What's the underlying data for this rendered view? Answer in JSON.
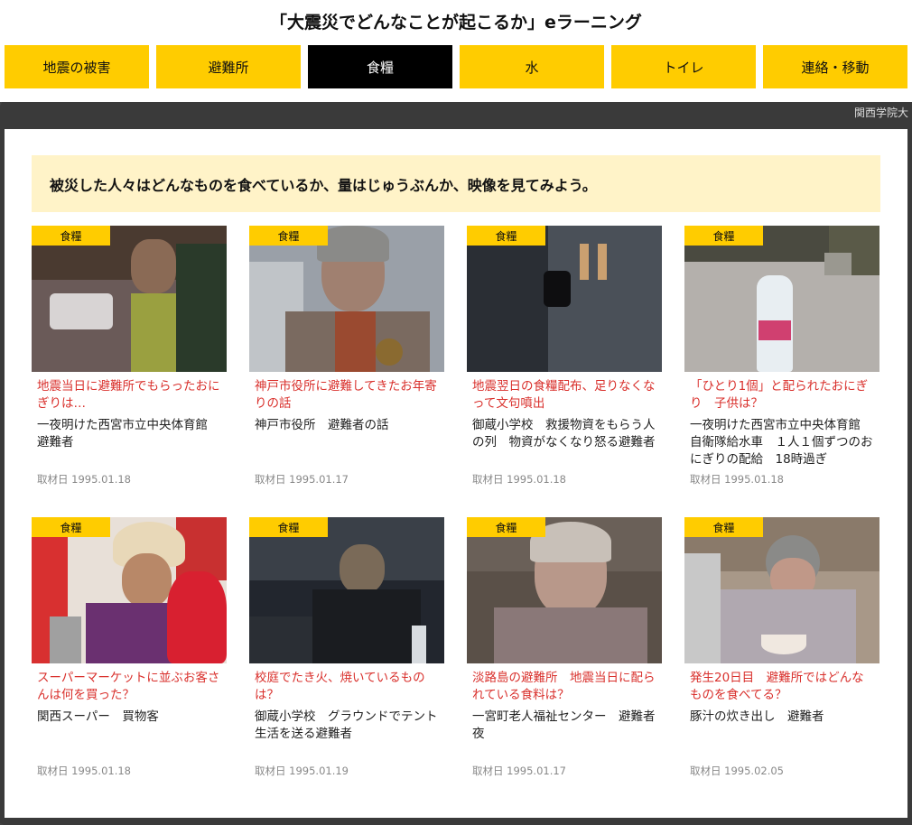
{
  "site": {
    "title": "「大震災でどんなことが起こるか」eラーニング"
  },
  "tabs": [
    {
      "label": "地震の被害",
      "active": false
    },
    {
      "label": "避難所",
      "active": false
    },
    {
      "label": "食糧",
      "active": true
    },
    {
      "label": "水",
      "active": false
    },
    {
      "label": "トイレ",
      "active": false
    },
    {
      "label": "連絡・移動",
      "active": false
    }
  ],
  "map": {
    "label": "関西学院大"
  },
  "intro": {
    "text": "被災した人々はどんなものを食べているか、量はじゅうぶんか、映像を見てみよう。"
  },
  "cards": [
    {
      "category": "食糧",
      "title": "地震当日に避難所でもらったおにぎりは…",
      "description": "一夜明けた西宮市立中央体育館　避難者",
      "date": "取材日 1995.01.18"
    },
    {
      "category": "食糧",
      "title": "神戸市役所に避難してきたお年寄りの話",
      "description": "神戸市役所　避難者の話",
      "date": "取材日 1995.01.17"
    },
    {
      "category": "食糧",
      "title": "地震翌日の食糧配布、足りなくなって文句噴出",
      "description": "御蔵小学校　救援物資をもらう人の列　物資がなくなり怒る避難者",
      "date": "取材日 1995.01.18"
    },
    {
      "category": "食糧",
      "title": "「ひとり1個」と配られたおにぎり　子供は？",
      "description": "一夜明けた西宮市立中央体育館　自衛隊給水車　１人１個ずつのおにぎりの配給　18時過ぎ",
      "date": "取材日 1995.01.18"
    },
    {
      "category": "食糧",
      "title": "スーパーマーケットに並ぶお客さんは何を買った？",
      "description": "関西スーパー　買物客",
      "date": "取材日 1995.01.18"
    },
    {
      "category": "食糧",
      "title": "校庭でたき火、焼いているものは？",
      "description": "御蔵小学校　グラウンドでテント生活を送る避難者",
      "date": "取材日 1995.01.19"
    },
    {
      "category": "食糧",
      "title": "淡路島の避難所　地震当日に配られている食料は？",
      "description": "一宮町老人福祉センター　避難者　夜",
      "date": "取材日 1995.01.17"
    },
    {
      "category": "食糧",
      "title": "発生20日目　避難所ではどんなものを食べてる？",
      "description": "豚汁の炊き出し　避難者",
      "date": "取材日 1995.02.05"
    }
  ]
}
